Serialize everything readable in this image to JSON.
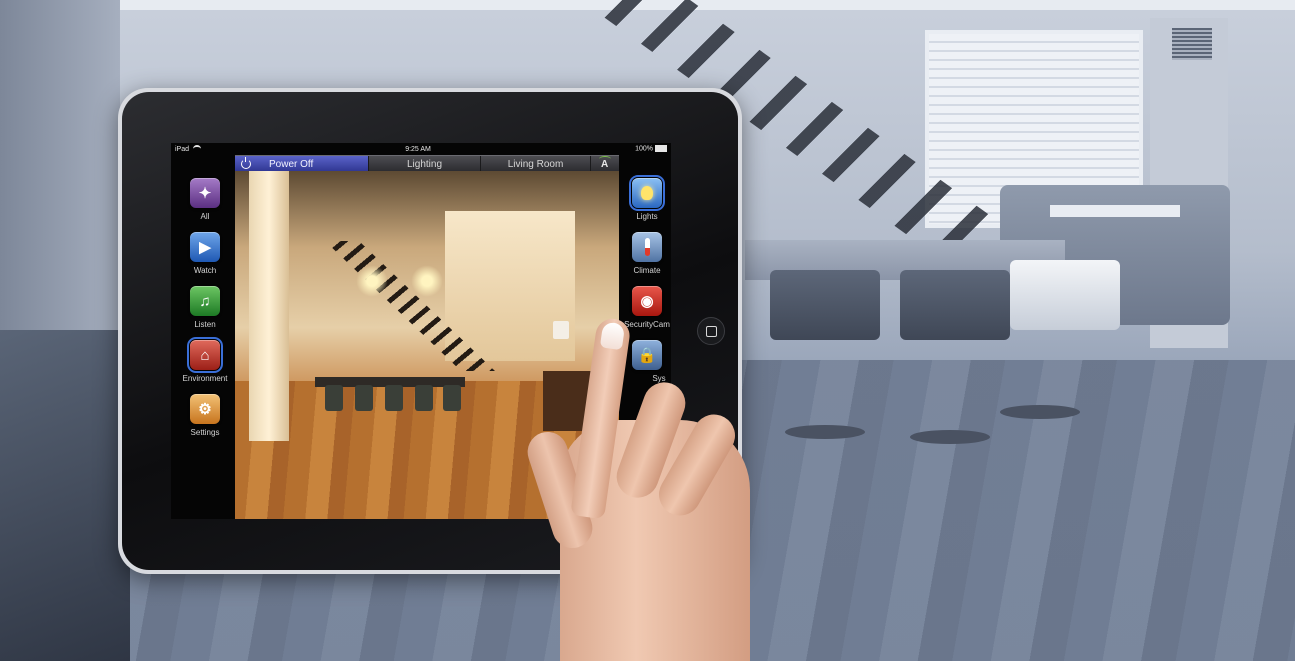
{
  "status_bar": {
    "device": "iPad",
    "time": "9:25 AM",
    "battery": "100%"
  },
  "top_bar": {
    "power_label": "Power Off",
    "lighting_label": "Lighting",
    "room_label": "Living Room",
    "selected": "power"
  },
  "left_menu": {
    "items": [
      {
        "label": "All",
        "icon": "compass-icon"
      },
      {
        "label": "Watch",
        "icon": "camera-icon"
      },
      {
        "label": "Listen",
        "icon": "music-note-icon"
      },
      {
        "label": "Environment",
        "icon": "house-icon"
      },
      {
        "label": "Settings",
        "icon": "gears-icon"
      }
    ],
    "selected": "Environment"
  },
  "right_menu": {
    "items": [
      {
        "label": "Lights",
        "icon": "lightbulb-icon"
      },
      {
        "label": "Climate",
        "icon": "thermometer-icon"
      },
      {
        "label": "SecurityCam",
        "icon": "security-camera-icon"
      },
      {
        "label": "Sys",
        "icon": "lock-icon"
      }
    ],
    "selected": "Lights"
  },
  "colors": {
    "power_active": "#3a42a8",
    "left_selected": "#3a6fd8"
  }
}
